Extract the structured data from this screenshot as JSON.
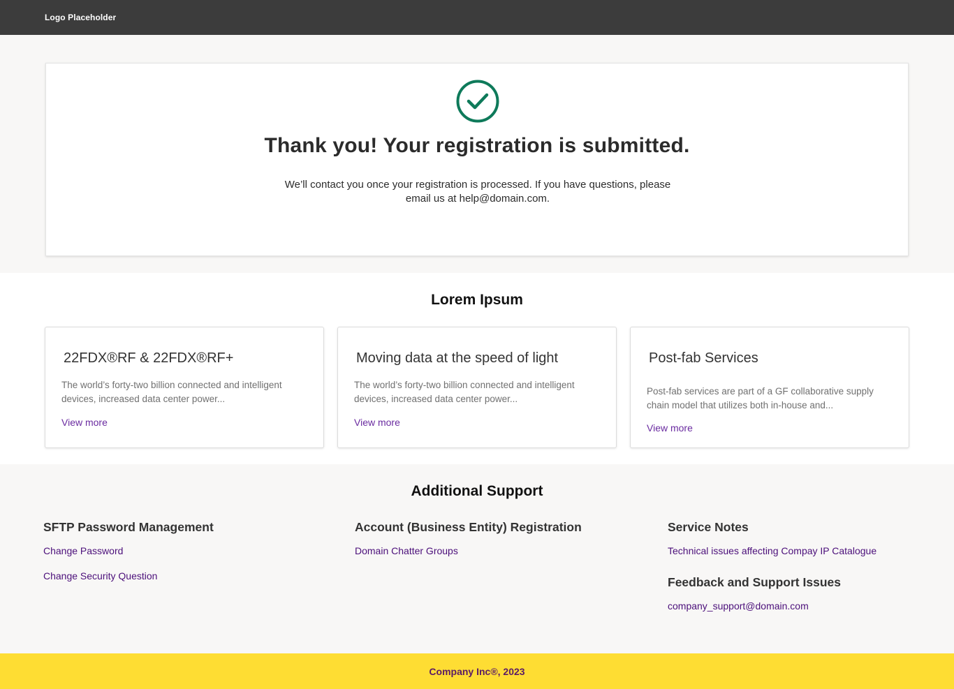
{
  "header": {
    "logo_text": "Logo Placeholder"
  },
  "confirmation": {
    "icon": "check-circle-icon",
    "icon_color": "#0e7a5a",
    "title": "Thank you! Your registration is submitted.",
    "message": "We’ll contact you once your registration is processed. If you have questions, please email us at help@domain.com."
  },
  "lorem": {
    "title": "Lorem Ipsum",
    "cards": [
      {
        "title": "22FDX®RF & 22FDX®RF+",
        "description": "The world’s forty-two billion connected and intelligent devices, increased data center power...",
        "link": "View more"
      },
      {
        "title": "Moving data at the speed of light",
        "description": "The world’s forty-two billion connected and intelligent devices, increased data center power...",
        "link": "View more"
      },
      {
        "title": "Post-fab Services",
        "description": "Post-fab services are part of a GF collaborative supply chain model that utilizes both in-house and...",
        "link": "View more"
      }
    ]
  },
  "support": {
    "title": "Additional Support",
    "columns": [
      {
        "heading": "SFTP Password Management",
        "links": [
          "Change Password",
          "Change Security Question"
        ]
      },
      {
        "heading": "Account (Business Entity) Registration",
        "links": [
          "Domain Chatter Groups"
        ]
      },
      {
        "heading": "Service Notes",
        "links": [
          "Technical issues affecting Compay IP Catalogue"
        ],
        "heading2": "Feedback and Support Issues",
        "links2": [
          "company_support@domain.com"
        ]
      }
    ]
  },
  "footer": {
    "text": "Company Inc®, 2023",
    "bg_color": "#fedd33"
  }
}
